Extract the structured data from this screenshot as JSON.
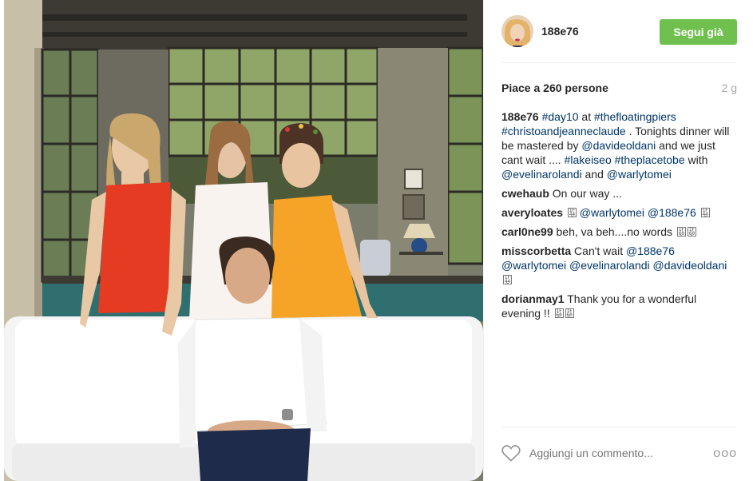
{
  "post": {
    "username": "188e76",
    "follow_label": "Segui già",
    "likes": "Piace a 260 persone",
    "time": "2 g",
    "caption": {
      "user": "188e76",
      "parts": [
        {
          "text": "#day10",
          "tag": true
        },
        {
          "text": " at ",
          "tag": false
        },
        {
          "text": "#thefloatingpiers",
          "tag": true
        },
        {
          "text": " ",
          "tag": false
        },
        {
          "text": "#christoandjeanneclaude",
          "tag": true
        },
        {
          "text": " . Tonights dinner will be mastered by ",
          "tag": false
        },
        {
          "text": "@davideoldani",
          "tag": true
        },
        {
          "text": " and we just cant wait .... ",
          "tag": false
        },
        {
          "text": "#lakeiseo",
          "tag": true
        },
        {
          "text": " ",
          "tag": false
        },
        {
          "text": "#theplacetobe",
          "tag": true
        },
        {
          "text": " with ",
          "tag": false
        },
        {
          "text": "@evelinarolandi",
          "tag": true
        },
        {
          "text": " and ",
          "tag": false
        },
        {
          "text": "@warlytomei",
          "tag": true
        }
      ]
    },
    "comments": [
      {
        "user": "cwehaub",
        "parts": [
          {
            "text": "On our way ...",
            "tag": false
          }
        ]
      },
      {
        "user": "averyloates",
        "parts": [
          {
            "emoji": "1F44F"
          },
          {
            "text": " ",
            "tag": false
          },
          {
            "text": "@warlytomei",
            "tag": true
          },
          {
            "text": " ",
            "tag": false
          },
          {
            "text": "@188e76",
            "tag": true
          },
          {
            "text": " ",
            "tag": false
          },
          {
            "emoji": "1F44F"
          }
        ]
      },
      {
        "user": "carl0ne99",
        "parts": [
          {
            "text": "beh, va beh....no words ",
            "tag": false
          },
          {
            "emoji": "1F60D"
          },
          {
            "emoji": "1F60D"
          }
        ]
      },
      {
        "user": "misscorbetta",
        "parts": [
          {
            "text": "Can't wait ",
            "tag": false
          },
          {
            "text": "@188e76",
            "tag": true
          },
          {
            "text": " ",
            "tag": false
          },
          {
            "text": "@warlytomei",
            "tag": true
          },
          {
            "text": " ",
            "tag": false
          },
          {
            "text": "@evelinarolandi",
            "tag": true
          },
          {
            "text": " ",
            "tag": false
          },
          {
            "text": "@davideoldani",
            "tag": true
          },
          {
            "text": " ",
            "tag": false
          },
          {
            "emoji": "1F44F"
          }
        ]
      },
      {
        "user": "dorianmay1",
        "parts": [
          {
            "text": "Thank you for a wonderful evening !! ",
            "tag": false
          },
          {
            "emoji": "1F60D"
          },
          {
            "emoji": "1F60D"
          }
        ]
      }
    ],
    "comment_placeholder": "Aggiungi un commento...",
    "more_label": "ooo"
  },
  "colors": {
    "follow_bg": "#70c050",
    "hashtag": "#003569",
    "muted": "#a5a7aa"
  },
  "icons": {
    "like": "heart-outline-icon",
    "more": "more-options-icon"
  }
}
